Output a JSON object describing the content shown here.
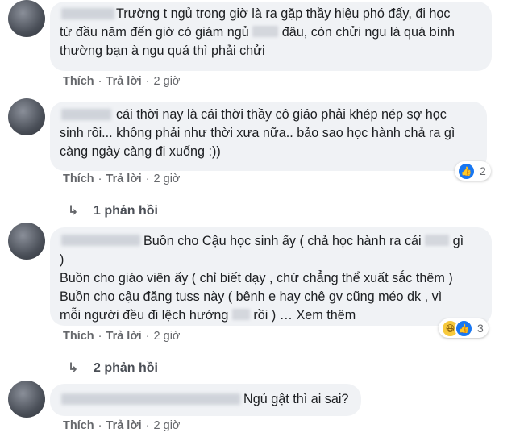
{
  "comments": [
    {
      "lines": [
        "Trường t ngủ trong giờ là ra gặp thầy hiệu phó đấy, đi học",
        "từ đầu năm đến giờ có giám ngủ",
        "đâu, còn chửi ngu là quá bình",
        "thường bạn à ngu quá thì phải chửi"
      ],
      "actions": {
        "like": "Thích",
        "reply": "Trả lời",
        "time": "2 giờ"
      }
    },
    {
      "lines": [
        "cái thời nay là cái thời thầy cô giáo phải khép nép sợ học",
        "sinh rồi... không phải như thời xưa nữa.. bảo sao học hành chả ra gì",
        "càng ngày càng đi xuống :))"
      ],
      "actions": {
        "like": "Thích",
        "reply": "Trả lời",
        "time": "2 giờ"
      },
      "reaction": {
        "icon": "like-icon",
        "count": "2"
      },
      "replies": "1 phản hồi"
    },
    {
      "lines": [
        "Buồn cho Cậu học sinh ấy ( chả học hành ra cái",
        "gì",
        ")",
        "Buồn cho giáo viên ấy ( chỉ biết dạy , chứ chẳng thể xuất sắc thêm )",
        "Buồn cho cậu đăng tuss này ( bênh e hay chê gv cũng méo dk , vì",
        "mỗi người đều đi lệch hướng",
        "rồi ) …",
        "Xem thêm"
      ],
      "actions": {
        "like": "Thích",
        "reply": "Trả lời",
        "time": "2 giờ"
      },
      "reaction": {
        "icons": [
          "haha-icon",
          "like-icon"
        ],
        "count": "3"
      },
      "replies": "2 phản hồi"
    },
    {
      "lines": [
        "Ngủ gật thì ai sai?"
      ],
      "actions": {
        "like": "Thích",
        "reply": "Trả lời",
        "time": "2 giờ"
      }
    }
  ],
  "separator": "·",
  "reply_icon": "reply-arrow-icon",
  "colors": {
    "bubble": "#f0f2f5",
    "meta": "#65676b",
    "like": "#1877f2"
  }
}
